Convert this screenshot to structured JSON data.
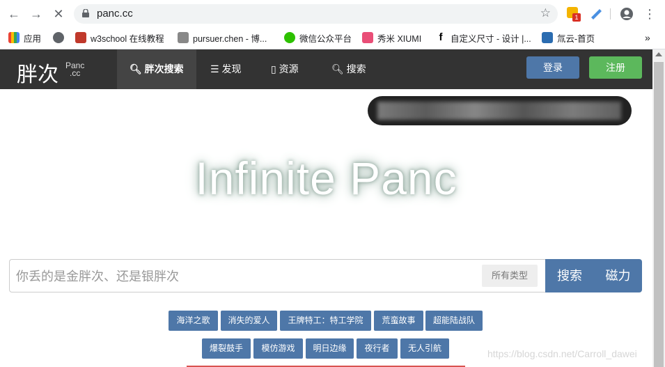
{
  "browser": {
    "url": "panc.cc",
    "badge_count": "1",
    "bookmarks": [
      {
        "label": "应用",
        "color": "#ea4335"
      },
      {
        "label": "",
        "color": "#5f6368"
      },
      {
        "label": "w3school 在线教程",
        "color": "#c0392b"
      },
      {
        "label": "pursuer.chen - 博...",
        "color": "#555555"
      },
      {
        "label": "微信公众平台",
        "color": "#2dc100"
      },
      {
        "label": "秀米 XIUMI",
        "color": "#e94e77"
      },
      {
        "label": "自定义尺寸 - 设计 |...",
        "color": "#000000"
      },
      {
        "label": "氚云-首页",
        "color": "#2b6cb0"
      }
    ],
    "more": "»"
  },
  "site": {
    "logo": "胖次",
    "logo_sub_1": "Panc",
    "logo_sub_2": ".cc",
    "nav": [
      {
        "label": "胖次搜索",
        "icon": "search-icon"
      },
      {
        "label": "发现",
        "icon": "list-icon"
      },
      {
        "label": "资源",
        "icon": "book-icon"
      },
      {
        "label": "搜索",
        "icon": "search-icon"
      }
    ],
    "login": "登录",
    "register": "注册"
  },
  "hero": {
    "title": "Infinite Panc"
  },
  "search": {
    "placeholder": "你丢的是金胖次、还是银胖次",
    "type": "所有类型",
    "search_button": "搜索",
    "magnet_button": "磁力"
  },
  "tags_row1": [
    "海洋之歌",
    "消失的爱人",
    "王牌特工：特工学院",
    "荒蛮故事",
    "超能陆战队"
  ],
  "tags_row2": [
    "爆裂鼓手",
    "模仿游戏",
    "明日边缘",
    "夜行者",
    "无人引航"
  ],
  "watermark": "https://blog.csdn.net/Carroll_dawei",
  "colors": {
    "primary": "#4e77a8",
    "success": "#5cb85c",
    "header": "#333333"
  }
}
